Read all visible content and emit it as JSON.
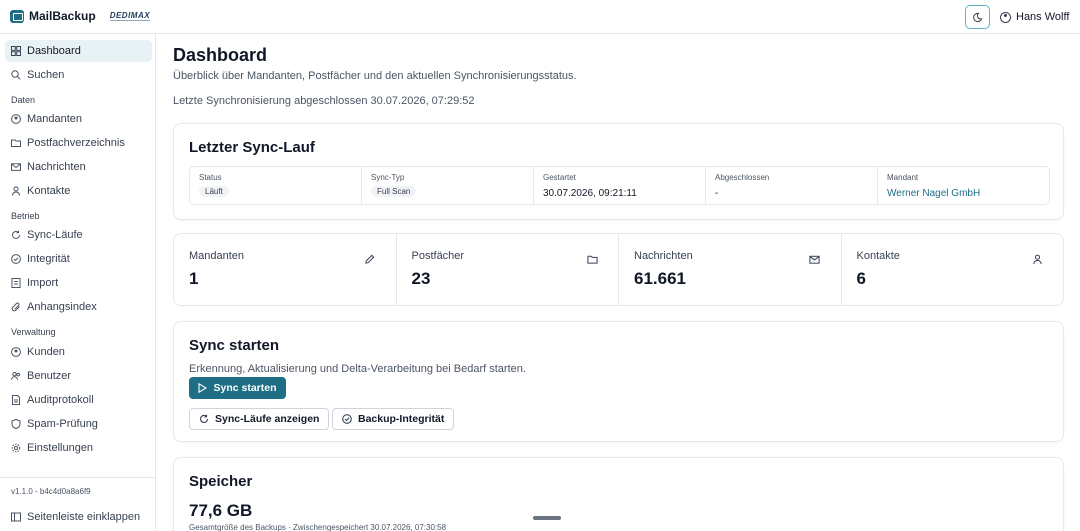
{
  "app": {
    "name": "MailBackup",
    "partner_logo": "DEDIMAX"
  },
  "user": {
    "name": "Hans Wolff"
  },
  "sidebar": {
    "items_top": [
      {
        "label": "Dashboard",
        "icon": "grid-icon",
        "active": true
      },
      {
        "label": "Suchen",
        "icon": "search-icon"
      }
    ],
    "section_daten": "Daten",
    "items_daten": [
      {
        "label": "Mandanten",
        "icon": "user-circle-icon"
      },
      {
        "label": "Postfachverzeichnis",
        "icon": "folder-icon"
      },
      {
        "label": "Nachrichten",
        "icon": "mail-icon"
      },
      {
        "label": "Kontakte",
        "icon": "contact-icon"
      }
    ],
    "section_betrieb": "Betrieb",
    "items_betrieb": [
      {
        "label": "Sync-Läufe",
        "icon": "refresh-icon"
      },
      {
        "label": "Integrität",
        "icon": "check-circle-icon"
      },
      {
        "label": "Import",
        "icon": "import-icon"
      },
      {
        "label": "Anhangsindex",
        "icon": "paperclip-icon"
      }
    ],
    "section_verwaltung": "Verwaltung",
    "items_verwaltung": [
      {
        "label": "Kunden",
        "icon": "user-circle-icon"
      },
      {
        "label": "Benutzer",
        "icon": "users-icon"
      },
      {
        "label": "Auditprotokoll",
        "icon": "document-icon"
      },
      {
        "label": "Spam-Prüfung",
        "icon": "shield-icon"
      },
      {
        "label": "Einstellungen",
        "icon": "gear-icon"
      }
    ],
    "version": "v1.1.0 - b4c4d0a8a6f9",
    "collapse_label": "Seitenleiste einklappen"
  },
  "page": {
    "title": "Dashboard",
    "subtitle": "Überblick über Mandanten, Postfächer und den aktuellen Synchronisierungsstatus.",
    "last_sync": "Letzte Synchronisierung abgeschlossen 30.07.2026, 07:29:52"
  },
  "last_run": {
    "title": "Letzter Sync-Lauf",
    "status_label": "Status",
    "status_value": "Läuft",
    "type_label": "Sync-Typ",
    "type_value": "Full Scan",
    "started_label": "Gestartet",
    "started_value": "30.07.2026, 09:21:11",
    "finished_label": "Abgeschlossen",
    "finished_value": "-",
    "client_label": "Mandant",
    "client_value": "Werner Nagel GmbH"
  },
  "stats": [
    {
      "label": "Mandanten",
      "value": "1",
      "icon": "pencil-icon"
    },
    {
      "label": "Postfächer",
      "value": "23",
      "icon": "folder-icon"
    },
    {
      "label": "Nachrichten",
      "value": "61.661",
      "icon": "mail-icon"
    },
    {
      "label": "Kontakte",
      "value": "6",
      "icon": "person-icon"
    }
  ],
  "sync_start": {
    "title": "Sync starten",
    "description": "Erkennung, Aktualisierung und Delta-Verarbeitung bei Bedarf starten.",
    "primary_button": "Sync starten",
    "runs_button": "Sync-Läufe anzeigen",
    "integrity_button": "Backup-Integrität"
  },
  "storage": {
    "title": "Speicher",
    "value": "77,6 GB",
    "subtitle": "Gesamtgröße des Backups · Zwischengespeichert 30.07.2026, 07:30:58"
  },
  "colors": {
    "accent": "#1e6e86",
    "active_bg": "#e8f1f4",
    "border": "#e5e7eb"
  }
}
